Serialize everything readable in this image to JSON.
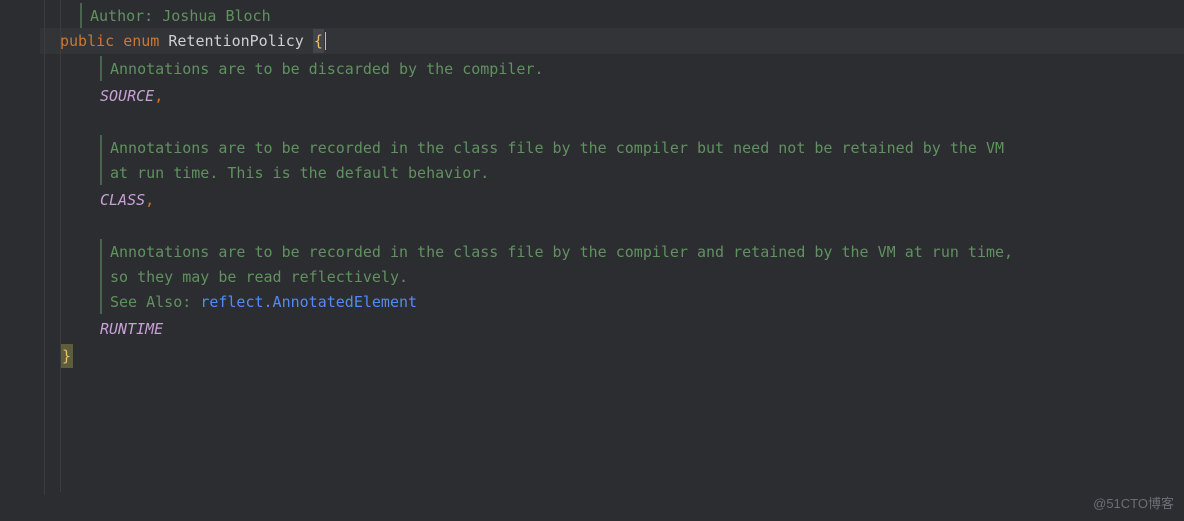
{
  "author_label": "Author:",
  "author_name": "Joshua Bloch",
  "kw_public": "public",
  "kw_enum": "enum",
  "class_name": "RetentionPolicy",
  "brace_open": "{",
  "brace_close": "}",
  "comma": ",",
  "doc_source": "Annotations are to be discarded by the compiler.",
  "const_source": "SOURCE",
  "doc_class_l1": "Annotations are to be recorded in the class file by the compiler but need not be retained by the VM",
  "doc_class_l2": "at run time. This is the default behavior.",
  "const_class": "CLASS",
  "doc_runtime_l1": "Annotations are to be recorded in the class file by the compiler and retained by the VM at run time,",
  "doc_runtime_l2": "so they may be read reflectively.",
  "see_also_label": "See Also:",
  "see_also_link": "reflect.AnnotatedElement",
  "const_runtime": "RUNTIME",
  "watermark": "@51CTO博客"
}
